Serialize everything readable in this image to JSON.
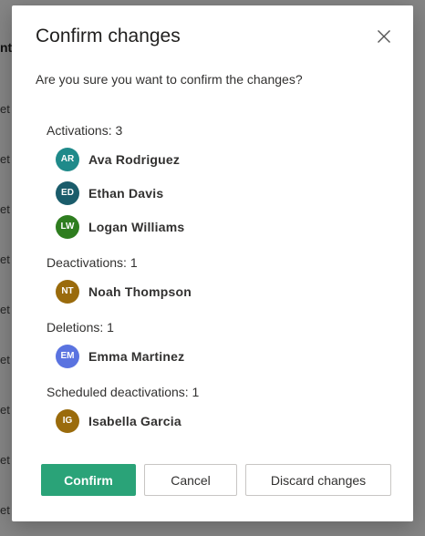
{
  "background": {
    "header_fragment": "nt",
    "row_fragment": "et"
  },
  "dialog": {
    "title": "Confirm changes",
    "subtitle": "Are you sure you want to confirm the changes?",
    "close_icon": "close-icon",
    "sections": [
      {
        "header": "Activations: 3",
        "people": [
          {
            "initials": "AR",
            "name": "Ava Rodriguez",
            "color": "#1f8a8a"
          },
          {
            "initials": "ED",
            "name": "Ethan Davis",
            "color": "#1a5c6b"
          },
          {
            "initials": "LW",
            "name": "Logan Williams",
            "color": "#2e7d1f"
          }
        ]
      },
      {
        "header": "Deactivations: 1",
        "people": [
          {
            "initials": "NT",
            "name": "Noah Thompson",
            "color": "#9a6b0c"
          }
        ]
      },
      {
        "header": "Deletions: 1",
        "people": [
          {
            "initials": "EM",
            "name": "Emma Martinez",
            "color": "#5a73e0"
          }
        ]
      },
      {
        "header": "Scheduled deactivations: 1",
        "people": [
          {
            "initials": "IG",
            "name": "Isabella Garcia",
            "color": "#9a6b0c"
          }
        ]
      }
    ],
    "buttons": {
      "confirm": "Confirm",
      "cancel": "Cancel",
      "discard": "Discard changes"
    },
    "colors": {
      "primary": "#2aa378"
    }
  }
}
